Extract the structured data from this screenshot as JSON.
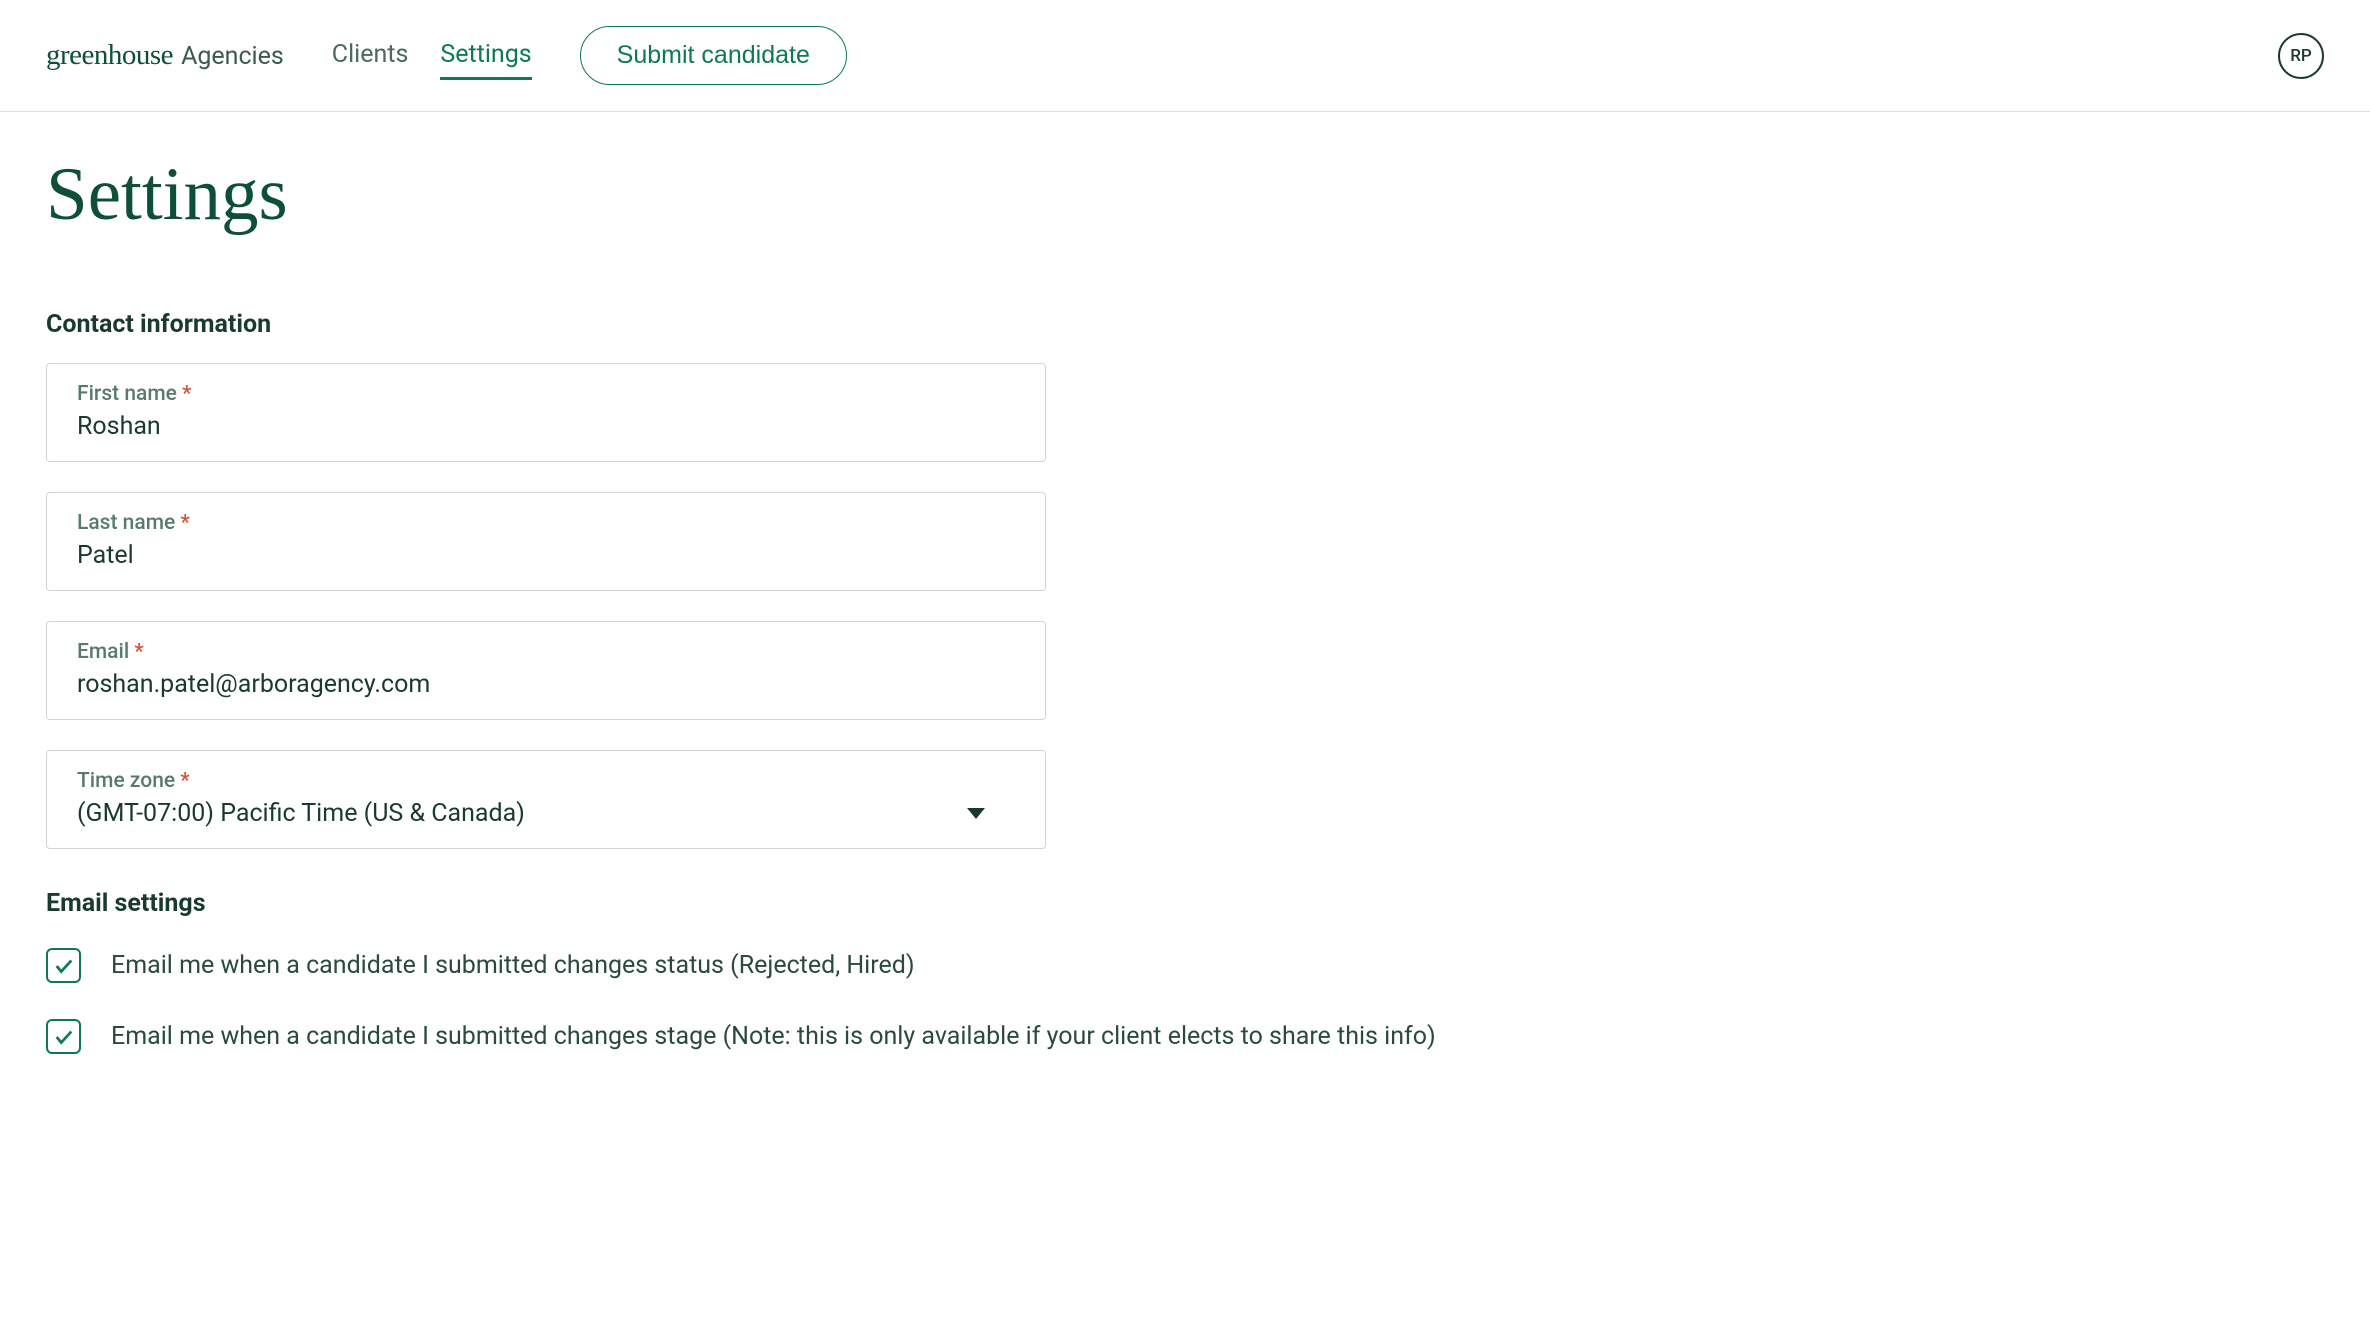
{
  "header": {
    "logo_primary": "greenhouse",
    "logo_secondary": "Agencies",
    "nav": {
      "clients": "Clients",
      "settings": "Settings"
    },
    "submit_btn": "Submit candidate",
    "avatar_initials": "RP"
  },
  "page": {
    "title": "Settings"
  },
  "contact": {
    "heading": "Contact information",
    "first_name": {
      "label": "First name",
      "value": "Roshan"
    },
    "last_name": {
      "label": "Last name",
      "value": "Patel"
    },
    "email": {
      "label": "Email",
      "value": "roshan.patel@arboragency.com"
    },
    "timezone": {
      "label": "Time zone",
      "value": "(GMT-07:00) Pacific Time (US & Canada)"
    }
  },
  "email_settings": {
    "heading": "Email settings",
    "option_status": {
      "label": "Email me when a candidate I submitted changes status (Rejected, Hired)",
      "checked": true
    },
    "option_stage": {
      "label": "Email me when a candidate I submitted changes stage (Note: this is only available if your client elects to share this info)",
      "checked": true
    }
  }
}
